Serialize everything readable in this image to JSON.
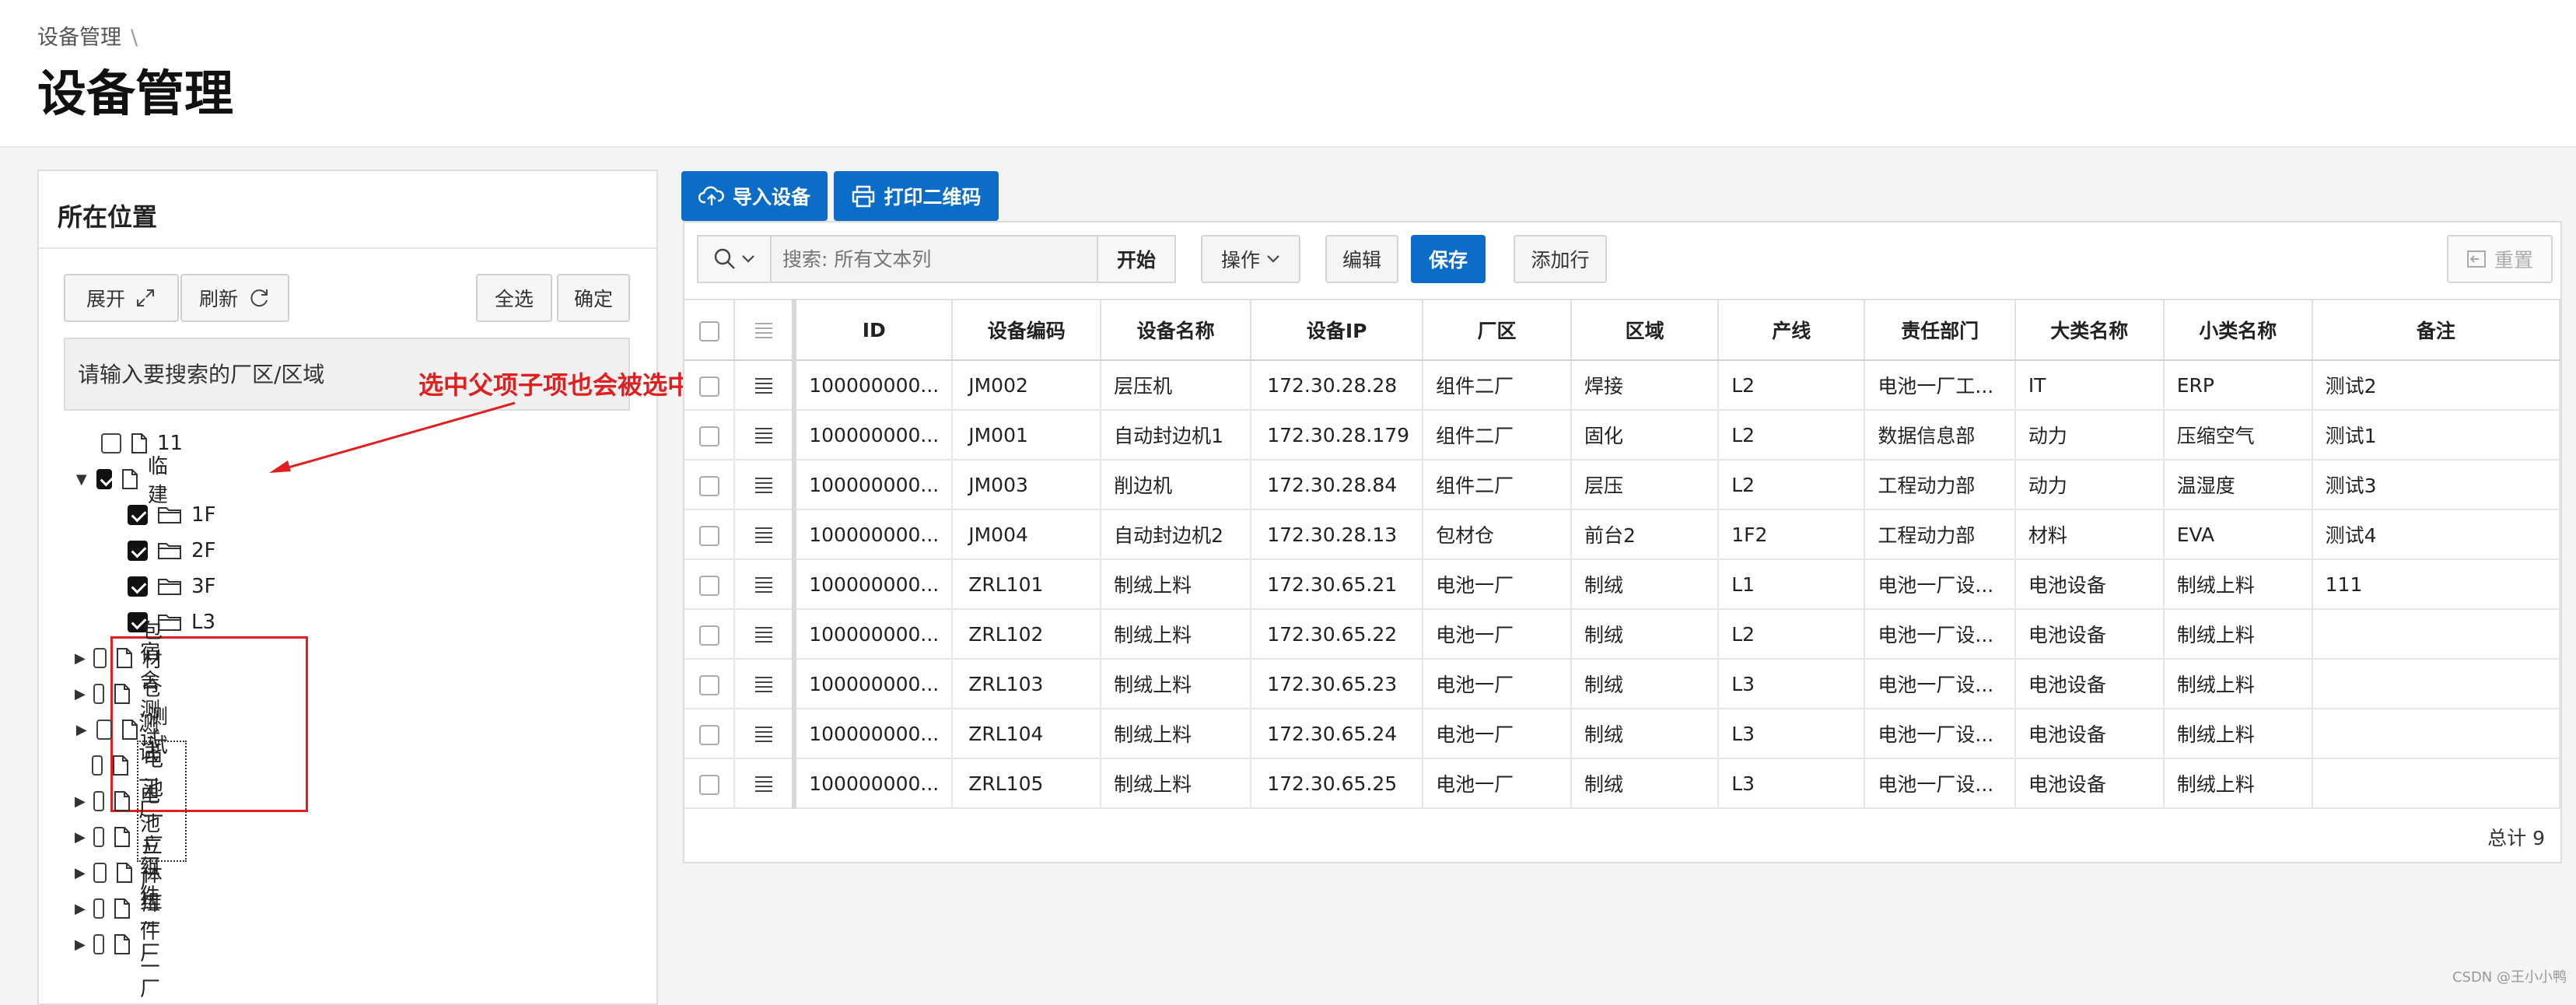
{
  "breadcrumb": {
    "item": "设备管理",
    "sep": "\\"
  },
  "title": "设备管理",
  "left": {
    "title": "所在位置",
    "buttons": {
      "expand": "展开",
      "refresh": "刷新",
      "select_all": "全选",
      "confirm": "确定"
    },
    "search_placeholder": "请输入要搜索的厂区/区域",
    "callout": "选中父项子项也会被选中",
    "tree": {
      "n11": "11",
      "linjian": "临建",
      "f1": "1F",
      "f2": "2F",
      "f3": "3F",
      "l3": "L3",
      "bcc": "包材仓",
      "ssc": "宿舍测试",
      "cs": "测试",
      "csyc": "测试一厂",
      "dc1": "电池一厂",
      "dc2": "电池二厂",
      "ltk": "立体库",
      "zj1": "组件一厂",
      "zj2": "组件二厂"
    }
  },
  "right": {
    "import_btn": "导入设备",
    "print_btn": "打印二维码",
    "search_placeholder": "搜索: 所有文本列",
    "go": "开始",
    "actions": "操作",
    "edit": "编辑",
    "save": "保存",
    "add_row": "添加行",
    "reset": "重置",
    "columns": [
      "ID",
      "设备编码",
      "设备名称",
      "设备IP",
      "厂区",
      "区域",
      "产线",
      "责任部门",
      "大类名称",
      "小类名称",
      "备注"
    ],
    "rows": [
      [
        "100000000...",
        "JM002",
        "层压机",
        "172.30.28.28",
        "组件二厂",
        "焊接",
        "L2",
        "电池一厂工...",
        "IT",
        "ERP",
        "测试2"
      ],
      [
        "100000000...",
        "JM001",
        "自动封边机1",
        "172.30.28.179",
        "组件二厂",
        "固化",
        "L2",
        "数据信息部",
        "动力",
        "压缩空气",
        "测试1"
      ],
      [
        "100000000...",
        "JM003",
        "削边机",
        "172.30.28.84",
        "组件二厂",
        "层压",
        "L2",
        "工程动力部",
        "动力",
        "温湿度",
        "测试3"
      ],
      [
        "100000000...",
        "JM004",
        "自动封边机2",
        "172.30.28.13",
        "包材仓",
        "前台2",
        "1F2",
        "工程动力部",
        "材料",
        "EVA",
        "测试4"
      ],
      [
        "100000000...",
        "ZRL101",
        "制绒上料",
        "172.30.65.21",
        "电池一厂",
        "制绒",
        "L1",
        "电池一厂设...",
        "电池设备",
        "制绒上料",
        "111"
      ],
      [
        "100000000...",
        "ZRL102",
        "制绒上料",
        "172.30.65.22",
        "电池一厂",
        "制绒",
        "L2",
        "电池一厂设...",
        "电池设备",
        "制绒上料",
        ""
      ],
      [
        "100000000...",
        "ZRL103",
        "制绒上料",
        "172.30.65.23",
        "电池一厂",
        "制绒",
        "L3",
        "电池一厂设...",
        "电池设备",
        "制绒上料",
        ""
      ],
      [
        "100000000...",
        "ZRL104",
        "制绒上料",
        "172.30.65.24",
        "电池一厂",
        "制绒",
        "L3",
        "电池一厂设...",
        "电池设备",
        "制绒上料",
        ""
      ],
      [
        "100000000...",
        "ZRL105",
        "制绒上料",
        "172.30.65.25",
        "电池一厂",
        "制绒",
        "L3",
        "电池一厂设...",
        "电池设备",
        "制绒上料",
        ""
      ]
    ],
    "total": "总计 9"
  },
  "watermark": "CSDN @王小小鸭"
}
